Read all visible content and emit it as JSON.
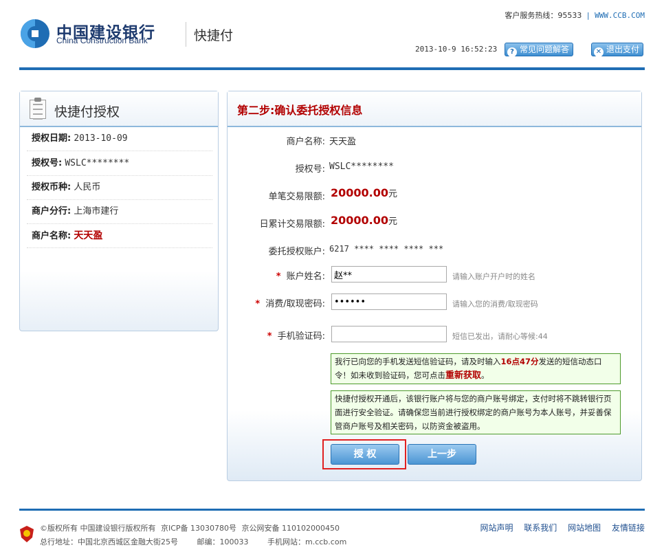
{
  "header": {
    "bank_name_cn": "中国建设银行",
    "bank_name_en": "China Construction Bank",
    "product": "快捷付",
    "hotline_label": "客户服务热线：95533",
    "website": "WWW.CCB.COM",
    "datetime": "2013-10-9 16:52:23",
    "faq_button": "常见问题解答",
    "exit_button": "退出支付",
    "faq_icon": "question-icon",
    "exit_icon": "close-icon"
  },
  "sidebar": {
    "title": "快捷付授权",
    "rows": [
      {
        "label": "授权日期:",
        "value": "2013-10-09"
      },
      {
        "label": "授权号:",
        "value": "WSLC********"
      },
      {
        "label": "授权币种:",
        "value": "人民币"
      },
      {
        "label": "商户分行:",
        "value": "上海市建行"
      },
      {
        "label": "商户名称:",
        "value": "天天盈"
      }
    ]
  },
  "main": {
    "step_title": "第二步:确认委托授权信息",
    "merchant_label": "商户名称:",
    "merchant_value": "天天盈",
    "auth_no_label": "授权号:",
    "auth_no_value": "WSLC********",
    "single_limit_label": "单笔交易限额:",
    "single_limit_value": "20000.00",
    "single_limit_unit": "元",
    "daily_limit_label": "日累计交易限额:",
    "daily_limit_value": "20000.00",
    "daily_limit_unit": "元",
    "account_label": "委托授权账户:",
    "account_value": "6217 **** **** **** ***",
    "required_mark": "*",
    "name_label": "账户姓名:",
    "name_value": "赵**",
    "name_hint": "请输入账户开户时的姓名",
    "password_label": "消费/取现密码:",
    "password_value": "******",
    "password_hint": "请输入您的消费/取现密码",
    "sms_label": "手机验证码:",
    "sms_value": "",
    "sms_hint": "短信已发出，请耐心等候:44",
    "notice1_part1": "我行已向您的手机发送短信验证码，请及时输入",
    "notice1_time": "16点47分",
    "notice1_part2": "发送的短信动态口令！如未收到验证码，您可点击",
    "notice1_link": "重新获取",
    "notice1_end": "。",
    "notice2": "快捷付授权开通后，该银行账户将与您的商户账号绑定，支付时将不跳转银行页面进行安全验证。请确保您当前进行授权绑定的商户账号为本人账号，并妥善保管商户账号及相关密码，以防资金被盗用。",
    "authorize_button": "授 权",
    "prev_button": "上一步"
  },
  "footer": {
    "copyright": "©版权所有 中国建设银行版权所有",
    "icp": "京ICP备 13030780号",
    "police": "京公网安备 110102000450",
    "address": "总行地址：中国北京西城区金融大街25号",
    "postcode": "邮编：100033",
    "mobile_site": "手机网站：m.ccb.com",
    "links": [
      "网站声明",
      "联系我们",
      "网站地图",
      "友情链接"
    ]
  },
  "colors": {
    "brand_blue": "#1f6db4",
    "accent_red": "#b20000",
    "notice_green": "#4c9a2a"
  }
}
